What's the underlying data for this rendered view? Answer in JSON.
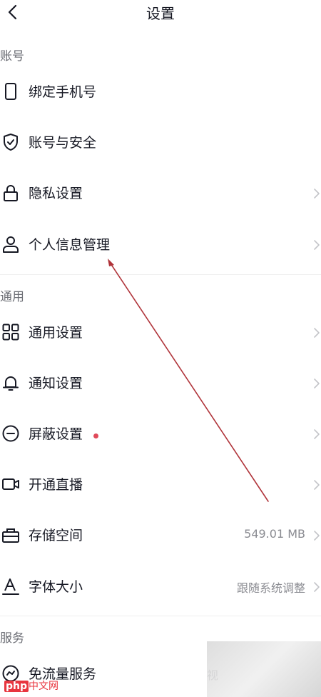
{
  "header": {
    "title": "设置",
    "back_icon": "chevron-left-icon"
  },
  "sections": {
    "account": "账号",
    "general": "通用",
    "services": "服务"
  },
  "account_items": [
    {
      "label": "绑定手机号",
      "icon": "phone-icon"
    },
    {
      "label": "账号与安全",
      "icon": "shield-check-icon"
    },
    {
      "label": "隐私设置",
      "icon": "lock-icon"
    },
    {
      "label": "个人信息管理",
      "icon": "person-icon"
    }
  ],
  "general_items": [
    {
      "label": "通用设置",
      "icon": "grid-icon"
    },
    {
      "label": "通知设置",
      "icon": "bell-icon"
    },
    {
      "label": "屏蔽设置",
      "icon": "block-icon"
    },
    {
      "label": "开通直播",
      "icon": "video-camera-icon"
    },
    {
      "label": "存储空间",
      "icon": "storage-box-icon",
      "value": "549.01 MB"
    },
    {
      "label": "字体大小",
      "icon": "font-size-icon",
      "value": "跟随系统调整"
    }
  ],
  "service_items": [
    {
      "label": "免流量服务",
      "icon": "flow-service-icon",
      "value": "视"
    }
  ],
  "notification_dot_color": "#e04a5a",
  "watermark": {
    "prefix": "php",
    "text": "中文网"
  }
}
